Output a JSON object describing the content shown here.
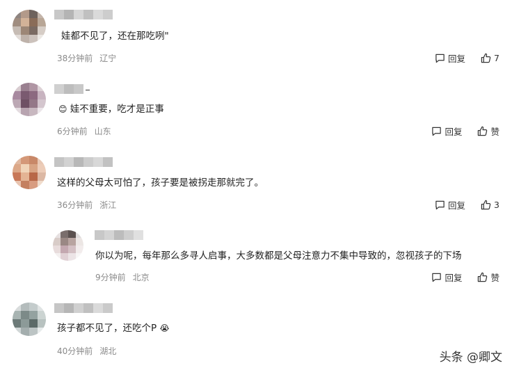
{
  "comments": [
    {
      "text": "娃都不见了，还在那吃咧\"",
      "time": "38分钟前",
      "location": "辽宁",
      "reply_label": "回复",
      "like_label": "7"
    },
    {
      "emoji": "😊",
      "text": "娃不重要，吃才是正事",
      "time": "6分钟前",
      "location": "山东",
      "reply_label": "回复",
      "like_label": "赞"
    },
    {
      "text": "这样的父母太可怕了，孩子要是被拐走那就完了。",
      "time": "36分钟前",
      "location": "浙江",
      "reply_label": "回复",
      "like_label": "3"
    },
    {
      "text": "你以为呢，每年那么多寻人启事，大多数都是父母注意力不集中导致的，忽视孩子的下场",
      "time": "9分钟前",
      "location": "北京",
      "reply_label": "回复",
      "like_label": "赞"
    },
    {
      "text": "孩子都不见了，还吃个P",
      "emoji_after": "😭",
      "time": "40分钟前",
      "location": "湖北"
    }
  ],
  "watermark": "头条 @卿文",
  "icons": {
    "reply": "comment-bubble-icon",
    "like": "thumbs-up-icon"
  }
}
